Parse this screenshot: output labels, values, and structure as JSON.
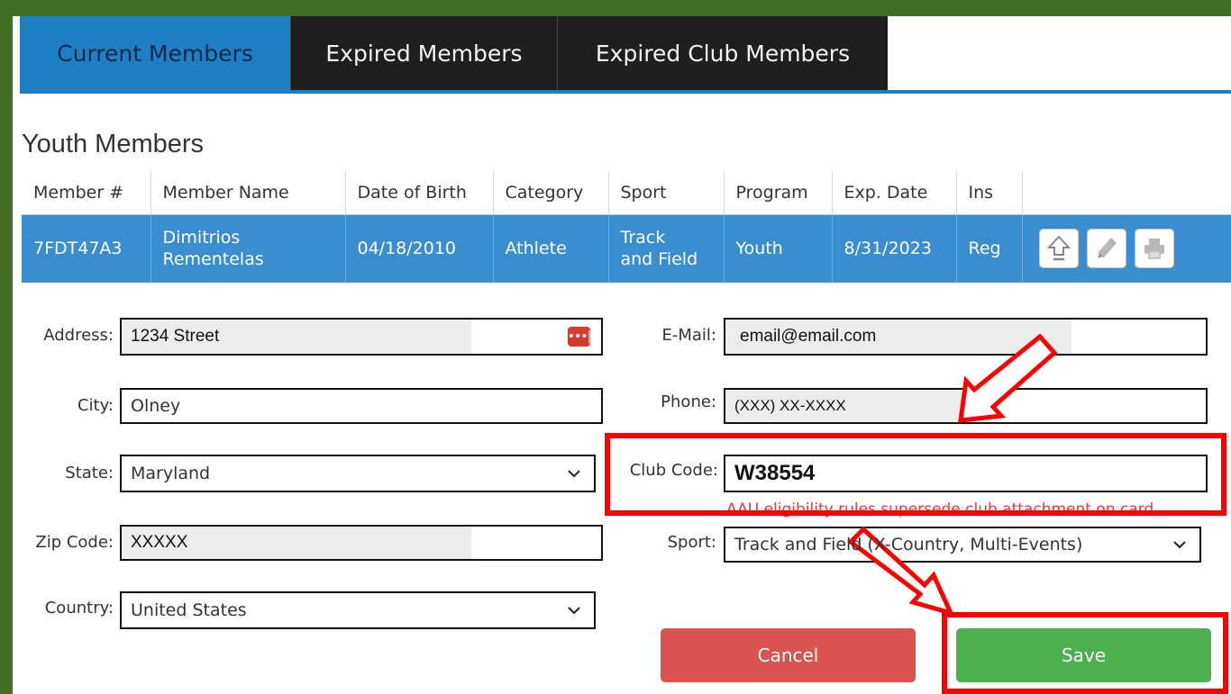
{
  "tabs": [
    {
      "label": "Current Members",
      "active": true
    },
    {
      "label": "Expired Members",
      "active": false
    },
    {
      "label": "Expired Club Members",
      "active": false
    }
  ],
  "section_title": "Youth Members",
  "table": {
    "headers": [
      "Member #",
      "Member Name",
      "Date of Birth",
      "Category",
      "Sport",
      "Program",
      "Exp. Date",
      "Ins"
    ],
    "row": {
      "member_no": "7FDT47A3",
      "name_line1": "Dimitrios",
      "name_line2": "Rementelas",
      "dob": "04/18/2010",
      "category": "Athlete",
      "sport_line1": "Track",
      "sport_line2": "and Field",
      "program": "Youth",
      "exp_date": "8/31/2023",
      "ins": "Reg"
    }
  },
  "form": {
    "address_label": "Address:",
    "address_value": "1234 Street",
    "city_label": "City:",
    "city_value": "Olney",
    "state_label": "State:",
    "state_value": "Maryland",
    "zip_label": "Zip Code:",
    "zip_value": "XXXXX",
    "country_label": "Country:",
    "country_value": "United States",
    "email_label": "E-Mail:",
    "email_value": "email@email.com",
    "phone_label": "Phone:",
    "phone_value": "(XXX) XX-XXXX",
    "club_code_label": "Club Code:",
    "club_code_value": "W38554",
    "club_warning": "AAU eligibility rules supersede club attachment on card.",
    "sport_label": "Sport:",
    "sport_value": "Track and Field (X-Country, Multi-Events)"
  },
  "buttons": {
    "cancel": "Cancel",
    "save": "Save"
  },
  "icons": {
    "password_manager": "ellipsis-icon",
    "upgrade": "upload-arrow-icon",
    "edit": "pencil-icon",
    "print": "printer-icon"
  },
  "colors": {
    "frame": "#3f6e24",
    "tab_active": "#1d7fc4",
    "row_highlight": "#3a8ed0",
    "cancel": "#d9534f",
    "save": "#4bb04d",
    "annotation": "#ff0000"
  }
}
